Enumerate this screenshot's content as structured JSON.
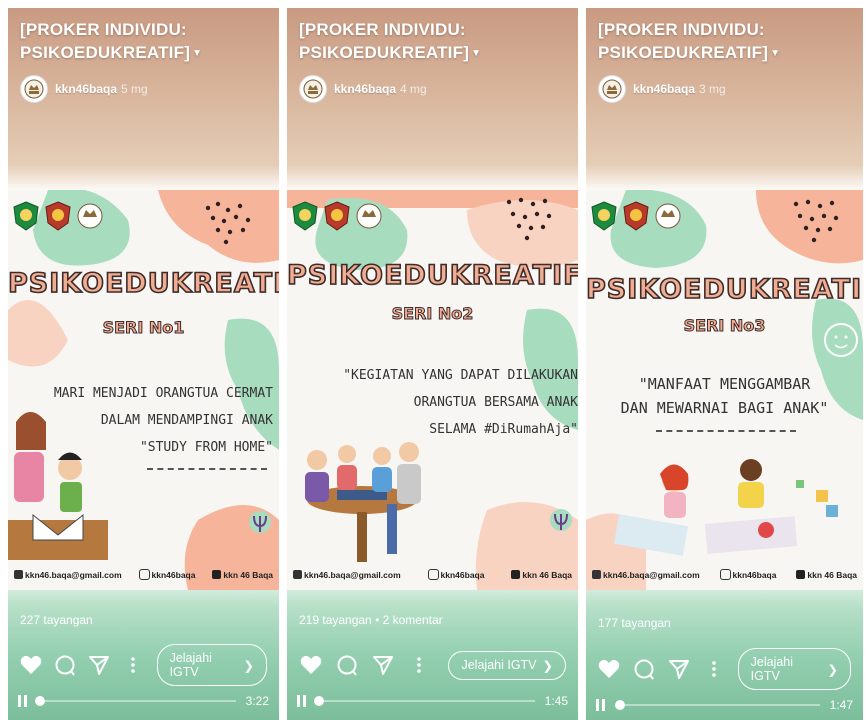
{
  "panels": [
    {
      "title": "[PROKER INDIVIDU:\nPSIKOEDUKREATIF]",
      "username": "kkn46baqa",
      "age": "5 mg",
      "poster": {
        "brand": "PSIKOEDUKREATIF",
        "seri": "SERI No1",
        "headline": "MARI MENJADI ORANGTUA CERMAT\nDALAM MENDAMPINGI ANAK\n\"STUDY FROM HOME\"",
        "email": "kkn46.baqa@gmail.com",
        "instagram": "kkn46baqa",
        "youtube": "kkn 46 Baqa"
      },
      "views": "227 tayangan",
      "igtv_label": "Jelajahi IGTV",
      "progress": 0.01,
      "duration": "3:22"
    },
    {
      "title": "[PROKER INDIVIDU:\nPSIKOEDUKREATIF]",
      "username": "kkn46baqa",
      "age": "4 mg",
      "poster": {
        "brand": "PSIKOEDUKREATIF",
        "seri": "SERI No2",
        "headline": "\"KEGIATAN YANG DAPAT DILAKUKAN\nORANGTUA BERSAMA ANAK\nSELAMA #DiRumahAja\"",
        "email": "kkn46.baqa@gmail.com",
        "instagram": "kkn46baqa",
        "youtube": "kkn 46 Baqa"
      },
      "views": "219 tayangan • 2 komentar",
      "igtv_label": "Jelajahi IGTV",
      "progress": 0.01,
      "duration": "1:45"
    },
    {
      "title": "[PROKER INDIVIDU:\nPSIKOEDUKREATIF]",
      "username": "kkn46baqa",
      "age": "3 mg",
      "poster": {
        "brand": "PSIKOEDUKREATIF",
        "seri": "SERI No3",
        "headline": "\"MANFAAT MENGGAMBAR\nDAN MEWARNAI BAGI ANAK\"",
        "email": "kkn46.baqa@gmail.com",
        "instagram": "kkn46baqa",
        "youtube": "kkn 46 Baqa"
      },
      "views": "177 tayangan",
      "igtv_label": "Jelajahi IGTV",
      "progress": 0.02,
      "duration": "1:47"
    }
  ],
  "colors": {
    "poster_peach": "#f2ad91",
    "poster_green": "#9ed8b8",
    "outline": "#3d2c2c"
  }
}
